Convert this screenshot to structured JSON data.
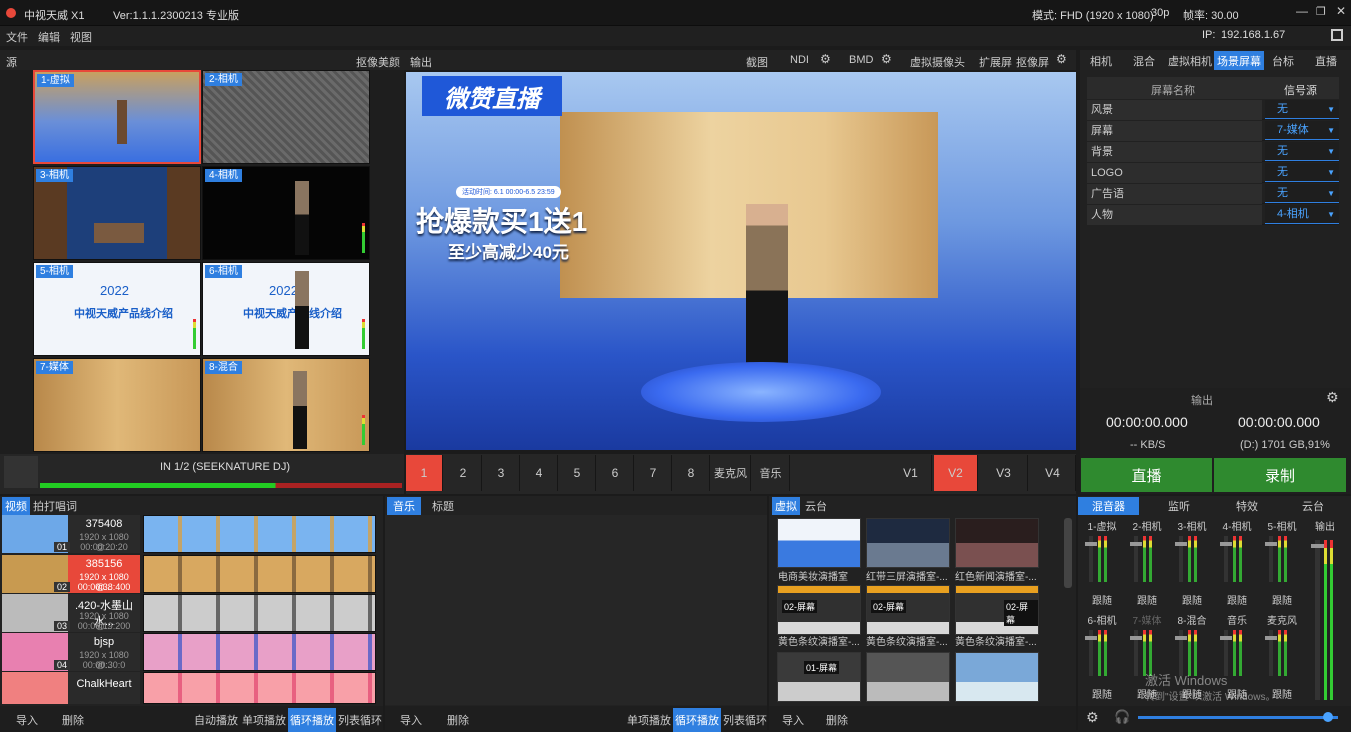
{
  "app": {
    "title": "中视天威 X1",
    "version": "Ver:1.1.1.2300213 专业版",
    "mode": "模式: FHD (1920 x 1080)",
    "fps": "30p",
    "framerate": "帧率: 30.00",
    "ip_label": "IP:",
    "ip": "192.168.1.67"
  },
  "menu": [
    "文件",
    "编辑",
    "视图"
  ],
  "source": {
    "label": "源",
    "beauty": "抠像美颜",
    "output": "输出",
    "tiles": [
      {
        "label": "1-虚拟"
      },
      {
        "label": "2-相机"
      },
      {
        "label": "3-相机"
      },
      {
        "label": "4-相机"
      },
      {
        "label": "5-相机"
      },
      {
        "label": "6-相机"
      },
      {
        "label": "7-媒体"
      },
      {
        "label": "8-混合"
      }
    ],
    "tile5_year": "2022",
    "tile5_text": "中视天威产品线介绍",
    "tile6_year": "2022",
    "tile6_text": "中视天威产品线介绍",
    "audio_input": "IN 1/2 (SEEKNATURE DJ)"
  },
  "toolbar": {
    "screenshot": "截图",
    "ndi": "NDI",
    "bmd": "BMD",
    "virtual_cam": "虚拟摄像头",
    "extend": "扩展屏",
    "keyscreen": "抠像屏"
  },
  "preview": {
    "logo": "微赞直播",
    "promo_time": "活动时间: 6.1 00:00-6.5 23:59",
    "promo_main": "抢爆款买1送1",
    "promo_sub": "至少高减少40元"
  },
  "switcher": {
    "nums": [
      "1",
      "2",
      "3",
      "4",
      "5",
      "6",
      "7",
      "8"
    ],
    "mic": "麦克风",
    "music": "音乐",
    "v": [
      "V1",
      "V2",
      "V3",
      "V4"
    ],
    "active_num": "1",
    "active_v": "V2"
  },
  "right_tabs": [
    "相机",
    "混合",
    "虚拟相机",
    "场景屏幕",
    "台标",
    "直播"
  ],
  "right_tab_active": "场景屏幕",
  "scene_table": {
    "col1": "屏幕名称",
    "col2": "信号源",
    "rows": [
      {
        "name": "风景",
        "value": "无"
      },
      {
        "name": "屏幕",
        "value": "7-媒体"
      },
      {
        "name": "背景",
        "value": "无"
      },
      {
        "name": "LOGO",
        "value": "无"
      },
      {
        "name": "广告语",
        "value": "无"
      },
      {
        "name": "人物",
        "value": "4-相机"
      }
    ]
  },
  "output": {
    "label": "输出",
    "time_live": "00:00:00.000",
    "time_rec": "00:00:00.000",
    "rate": "-- KB/S",
    "disk": "(D:) 1701 GB,91%",
    "live_btn": "直播",
    "record_btn": "录制"
  },
  "video": {
    "tabs": [
      "视频",
      "拍打唱词"
    ],
    "items": [
      {
        "title": "375408",
        "res": "1920 x 1080 @...",
        "dur": "00:00:20:20",
        "num": "01"
      },
      {
        "title": "385156",
        "res": "1920 x 1080 @...",
        "dur": "00:00:38:400",
        "num": "02"
      },
      {
        "title": ".420-水墨山水...",
        "res": "1920 x 1080 @...",
        "dur": "00:00:19:200",
        "num": "03"
      },
      {
        "title": "bjsp",
        "res": "1920 x 1080 @...",
        "dur": "00:00:30:0",
        "num": "04"
      },
      {
        "title": "ChalkHeart",
        "res": "",
        "dur": "",
        "num": ""
      }
    ],
    "import": "导入",
    "delete": "删除",
    "auto": "自动播放",
    "single": "单项播放",
    "loop": "循环播放",
    "list_loop": "列表循环"
  },
  "music": {
    "tabs": [
      "音乐",
      "标题"
    ],
    "import": "导入",
    "delete": "删除",
    "single": "单项播放",
    "loop": "循环播放",
    "list_loop": "列表循环"
  },
  "virtual": {
    "tabs": [
      "虚拟",
      "云台"
    ],
    "scenes": [
      {
        "label": "电商美妆演播室"
      },
      {
        "label": "红带三屏演播室-..."
      },
      {
        "label": "红色新闻演播室-..."
      },
      {
        "label": "黄色条纹演播室-..."
      },
      {
        "label": "黄色条纹演播室-..."
      },
      {
        "label": "黄色条纹演播室-..."
      },
      {
        "label": ""
      },
      {
        "label": ""
      },
      {
        "label": ""
      }
    ],
    "scene_texts": [
      "02-屏幕",
      "02-屏幕",
      "02-屏幕",
      "01-屏幕"
    ],
    "import": "导入",
    "delete": "删除"
  },
  "mixer": {
    "tabs": [
      "混音器",
      "监听",
      "特效",
      "云台"
    ],
    "row1": [
      {
        "name": "1-虚拟",
        "btn": "跟随"
      },
      {
        "name": "2-相机",
        "btn": "跟随"
      },
      {
        "name": "3-相机",
        "btn": "跟随"
      },
      {
        "name": "4-相机",
        "btn": "跟随"
      },
      {
        "name": "5-相机",
        "btn": "跟随"
      }
    ],
    "row2": [
      {
        "name": "6-相机",
        "btn": "跟随"
      },
      {
        "name": "7-媒体",
        "btn": "跟随"
      },
      {
        "name": "8-混合",
        "btn": "跟随"
      },
      {
        "name": "音乐",
        "btn": "跟随"
      },
      {
        "name": "麦克风",
        "btn": "跟随"
      }
    ],
    "output": "输出",
    "volume": 0.95
  },
  "watermark": {
    "line1": "激活 Windows",
    "line2": "转到\"设置\"以激活 Windows。"
  }
}
